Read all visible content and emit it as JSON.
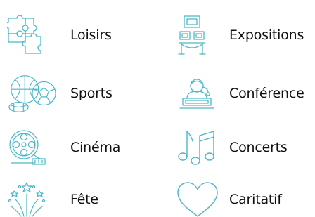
{
  "categories": [
    {
      "label": "Loisirs",
      "icon": "puzzle-icon"
    },
    {
      "label": "Expositions",
      "icon": "exhibition-icon"
    },
    {
      "label": "Sports",
      "icon": "sports-balls-icon"
    },
    {
      "label": "Conférence",
      "icon": "speaker-podium-icon"
    },
    {
      "label": "Cinéma",
      "icon": "film-reel-icon"
    },
    {
      "label": "Concerts",
      "icon": "music-notes-icon"
    },
    {
      "label": "Fête",
      "icon": "fireworks-icon"
    },
    {
      "label": "Caritatif",
      "icon": "heart-icon"
    }
  ],
  "colors": {
    "icon": "#4bb8c8",
    "text": "#111111",
    "background": "#ffffff"
  }
}
